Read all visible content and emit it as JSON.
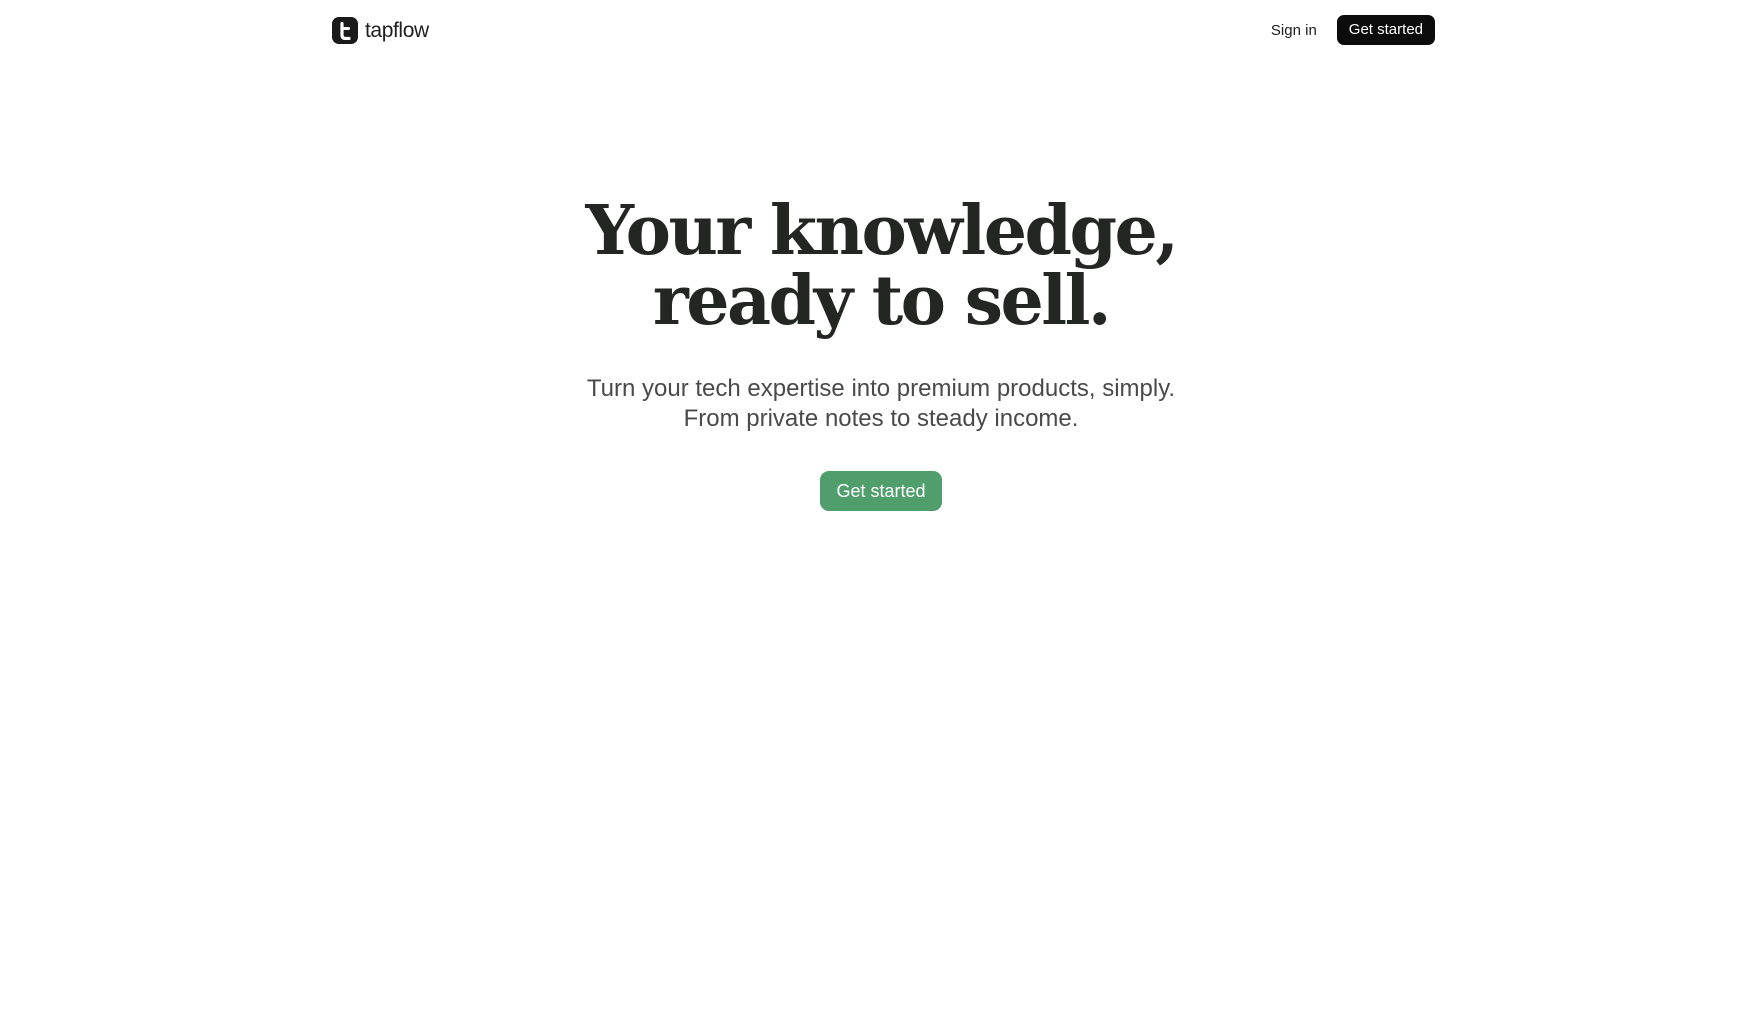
{
  "nav": {
    "brand_name": "tapflow",
    "logo_icon": "tapflow-logo-icon",
    "signin_label": "Sign in",
    "cta_label": "Get started"
  },
  "hero": {
    "headline_line1": "Your knowledge,",
    "headline_line2": "ready to sell.",
    "subline_line1": "Turn your tech expertise into premium products, simply.",
    "subline_line2": "From private notes to steady income.",
    "cta_label": "Get started"
  },
  "colors": {
    "primary_cta": "#4f9e6c",
    "nav_cta": "#0c0c0c",
    "headline": "#242624",
    "body_text": "#4a4a4a",
    "background": "#ffffff"
  }
}
